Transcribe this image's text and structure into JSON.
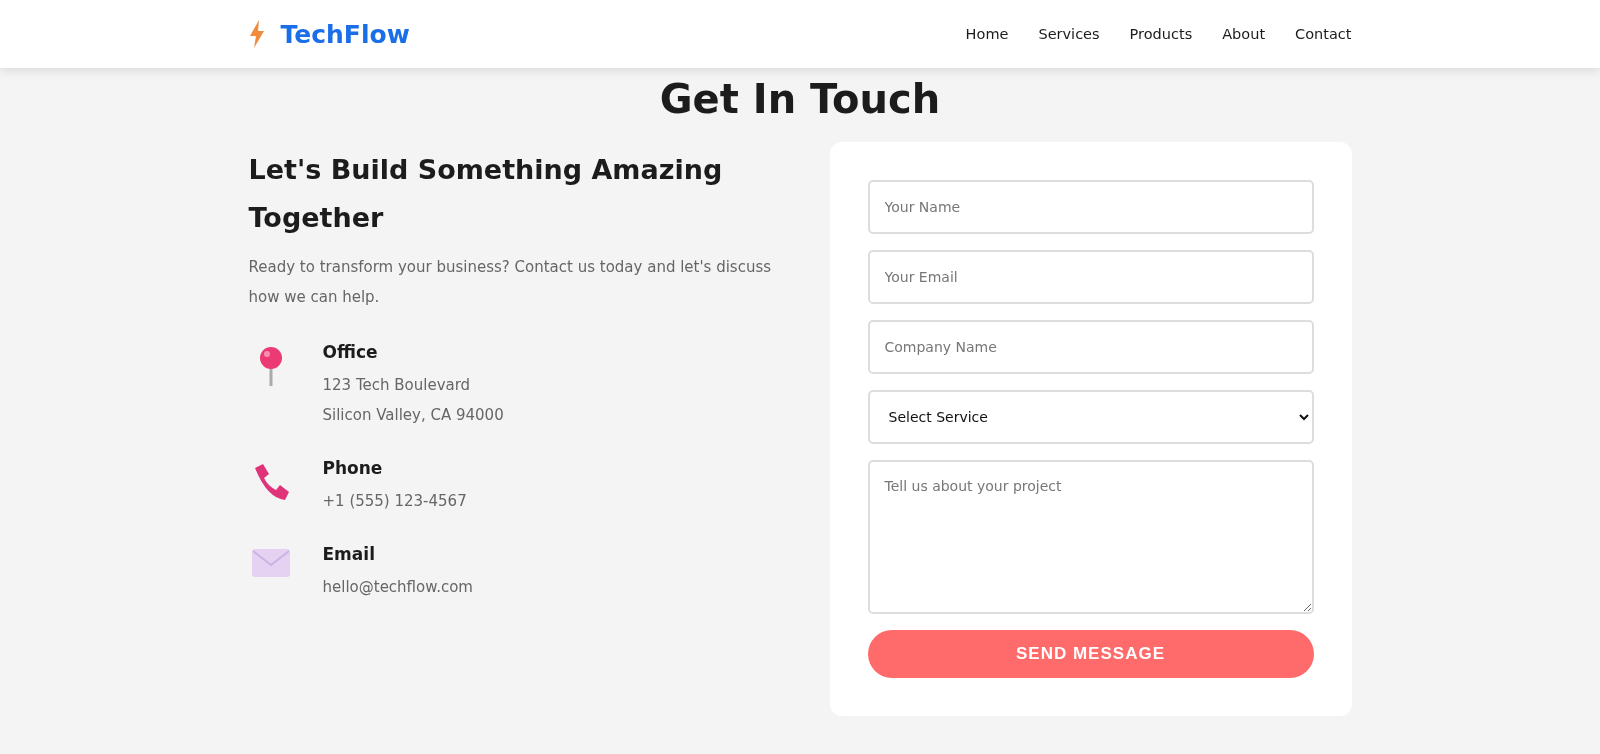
{
  "header": {
    "logo": "TechFlow",
    "nav": [
      {
        "label": "Home"
      },
      {
        "label": "Services"
      },
      {
        "label": "Products"
      },
      {
        "label": "About"
      },
      {
        "label": "Contact"
      }
    ]
  },
  "title": "Get In Touch",
  "intro": {
    "heading": "Let's Build Something Amazing Together",
    "text": "Ready to transform your business? Contact us today and let's discuss how we can help."
  },
  "contacts": [
    {
      "kind": "office",
      "label": "Office",
      "lines": [
        "123 Tech Boulevard",
        "Silicon Valley, CA 94000"
      ]
    },
    {
      "kind": "phone",
      "label": "Phone",
      "lines": [
        "+1 (555) 123-4567"
      ]
    },
    {
      "kind": "email",
      "label": "Email",
      "lines": [
        "hello@techflow.com"
      ]
    }
  ],
  "form": {
    "fields": [
      {
        "kind": "text",
        "placeholder": "Your Name"
      },
      {
        "kind": "text",
        "placeholder": "Your Email"
      },
      {
        "kind": "text",
        "placeholder": "Company Name"
      },
      {
        "kind": "select",
        "value": "Select Service"
      },
      {
        "kind": "textarea",
        "placeholder": "Tell us about your project"
      }
    ],
    "submit": "SEND MESSAGE"
  }
}
